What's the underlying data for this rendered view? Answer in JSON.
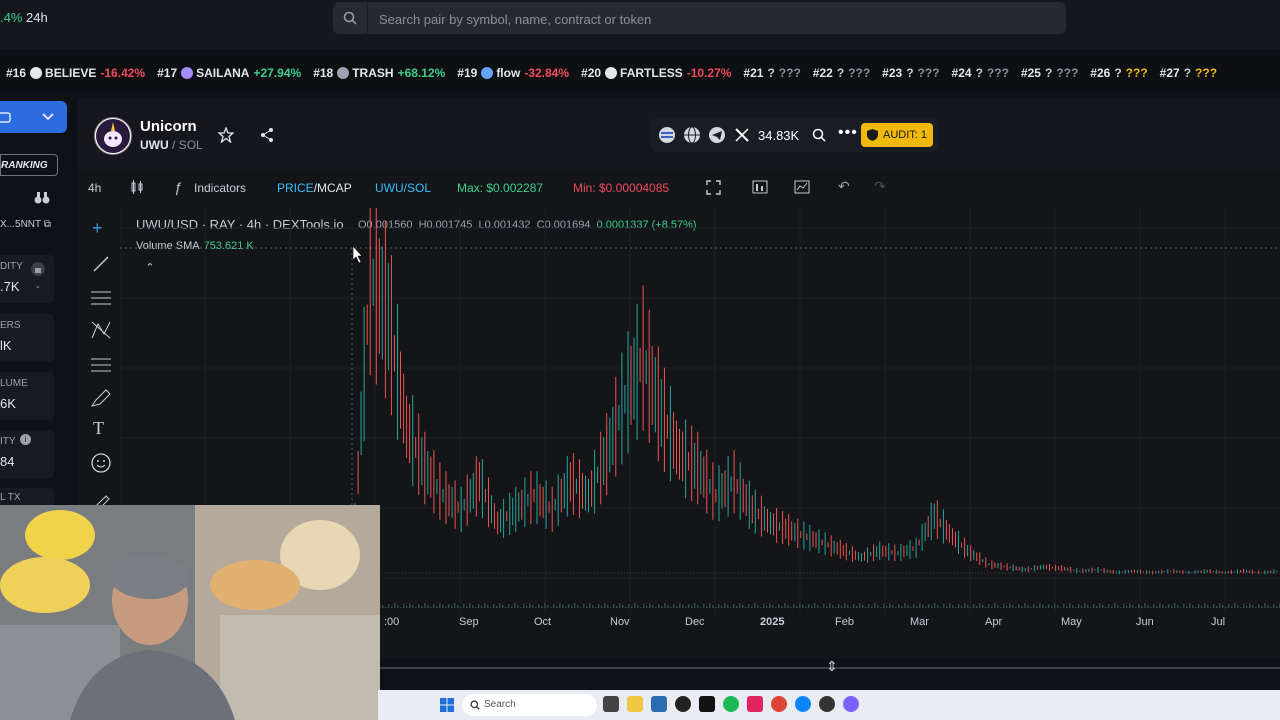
{
  "top": {
    "range_pct": ".4%",
    "range_label": "24h",
    "search_placeholder": "Search pair by symbol, name, contract or token"
  },
  "ticker": [
    {
      "rank": "#16",
      "name": "BELIEVE",
      "change": "-16.42%",
      "dir": "dn"
    },
    {
      "rank": "#17",
      "name": "SAILANA",
      "change": "+27.94%",
      "dir": "up"
    },
    {
      "rank": "#18",
      "name": "TRASH",
      "change": "+68.12%",
      "dir": "up"
    },
    {
      "rank": "#19",
      "name": "flow",
      "change": "-32.84%",
      "dir": "dn"
    },
    {
      "rank": "#20",
      "name": "FARTLESS",
      "change": "-10.27%",
      "dir": "dn"
    },
    {
      "rank": "#21",
      "name": "?",
      "change": "???",
      "dir": "q"
    },
    {
      "rank": "#22",
      "name": "?",
      "change": "???",
      "dir": "q"
    },
    {
      "rank": "#23",
      "name": "?",
      "change": "???",
      "dir": "q"
    },
    {
      "rank": "#24",
      "name": "?",
      "change": "???",
      "dir": "q"
    },
    {
      "rank": "#25",
      "name": "?",
      "change": "???",
      "dir": "q"
    },
    {
      "rank": "#26",
      "name": "?",
      "change": "???",
      "dir": "qy"
    },
    {
      "rank": "#27",
      "name": "?",
      "change": "???",
      "dir": "qy"
    }
  ],
  "left_panel": {
    "ranking_label": "RANKING",
    "address": "X...5NNT",
    "cards": [
      {
        "label": "DITY",
        "value": ".7K"
      },
      {
        "label": "ERS",
        "value": "lK"
      },
      {
        "label": "LUME",
        "value": "6K"
      },
      {
        "label": "ITY",
        "value": "84"
      },
      {
        "label": "L TX",
        "value": ""
      }
    ]
  },
  "token": {
    "name": "Unicorn",
    "symbol": "UWU",
    "chain": "/ SOL",
    "followers": "34.83K",
    "audit": "AUDIT: 1"
  },
  "toolbar": {
    "interval": "4h",
    "indicators": "Indicators",
    "price_mcap_a": "PRICE",
    "price_mcap_b": "/MCAP",
    "pair": "UWU/SOL",
    "max": "Max: $0.002287",
    "min": "Min: $0.00004085"
  },
  "chart_header": {
    "title": "UWU/USD · RAY · 4h · DEXTools.io",
    "o": "O0.001560",
    "h": "H0.001745",
    "l": "L0.001432",
    "c": "C0.001694",
    "chg": "0.0001337 (+8.57%)",
    "volume_label": "Volume SMA",
    "volume_value": "753.621 K"
  },
  "chart_data": {
    "type": "line",
    "x_ticks": [
      ":00",
      "Sep",
      "Oct",
      "Nov",
      "Dec",
      "2025",
      "Feb",
      "Mar",
      "Apr",
      "May",
      "Jun",
      "Jul"
    ],
    "series": [
      {
        "values": [
          5e-05,
          0.0022,
          0.0019,
          0.0011,
          0.0008,
          0.0006,
          0.0005,
          0.0007,
          0.0004,
          0.0005,
          0.0006,
          0.0005,
          0.0007,
          0.0006,
          0.0009,
          0.0013,
          0.0016,
          0.0012,
          0.0009,
          0.0008,
          0.0006,
          0.0007,
          0.0005,
          0.0004,
          0.00035,
          0.0003,
          0.00025,
          0.0002,
          0.00015,
          0.0002,
          0.00018,
          0.00022,
          0.00045,
          0.0003,
          0.00018,
          0.0001,
          8e-05,
          6e-05,
          8e-05,
          7e-05,
          5e-05,
          6e-05,
          4e-05,
          5e-05,
          4e-05,
          5e-05,
          4e-05,
          5e-05,
          4e-05,
          5e-05,
          4e-05,
          5e-05
        ]
      }
    ],
    "ylim": [
      0,
      0.0024
    ],
    "colors": {
      "up": "#26a69a",
      "down": "#ef5350"
    }
  },
  "taskbar": {
    "search": "Search"
  }
}
